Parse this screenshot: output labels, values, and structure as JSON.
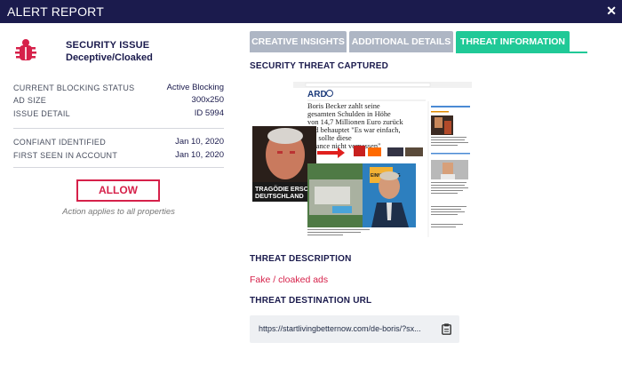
{
  "window": {
    "title": "ALERT REPORT",
    "close_icon": "close-icon"
  },
  "issue": {
    "icon": "bug-icon",
    "title": "SECURITY ISSUE",
    "subtitle": "Deceptive/Cloaked"
  },
  "details": [
    {
      "label": "CURRENT BLOCKING STATUS",
      "value": "Active Blocking"
    },
    {
      "label": "AD SIZE",
      "value": "300x250"
    },
    {
      "label": "ISSUE DETAIL",
      "value": "ID 5994"
    }
  ],
  "dates": [
    {
      "label": "CONFIANT IDENTIFIED",
      "value": "Jan 10, 2020"
    },
    {
      "label": "FIRST SEEN IN ACCOUNT",
      "value": "Jan 10, 2020"
    }
  ],
  "actions": {
    "allow_label": "ALLOW",
    "allow_note": "Action applies to all properties"
  },
  "tabs": [
    {
      "label": "CREATIVE INSIGHTS"
    },
    {
      "label": "ADDITIONAL DETAILS"
    },
    {
      "label": "THREAT INFORMATION"
    }
  ],
  "threat": {
    "captured_heading": "SECURITY THREAT CAPTURED",
    "description_heading": "THREAT DESCRIPTION",
    "description": "Fake / cloaked ads",
    "url_heading": "THREAT DESTINATION URL",
    "url": "https://startlivingbetternow.com/de-boris/?sx...",
    "copy_icon": "clipboard-icon"
  },
  "screenshot": {
    "url_bar": "https://startlivingbetternow.com/de-boris/",
    "logo": "ARD",
    "headline": "Boris Becker zahlt seine gesamten Schulden in Höhe von 14,7 Millionen Euro zurück und behauptet \"Es war einfach, ich sollte diese ... verpassen\"",
    "caption_line1": "TRAGÖDIE ERSCHÜTTERT",
    "caption_line2": "DEUTSCHLAND",
    "badge": "EINMELDUNG"
  },
  "colors": {
    "titlebar": "#1b1b4d",
    "accent": "#20c997",
    "danger": "#d6214a",
    "tab_inactive": "#aeb6c4"
  }
}
